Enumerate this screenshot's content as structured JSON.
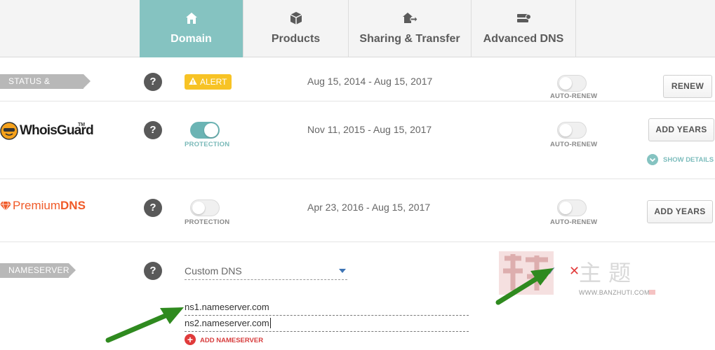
{
  "tabs": [
    {
      "label": "Domain",
      "icon": "home-icon",
      "active": true
    },
    {
      "label": "Products",
      "icon": "box-icon",
      "active": false
    },
    {
      "label": "Sharing & Transfer",
      "icon": "transfer-icon",
      "active": false
    },
    {
      "label": "Advanced DNS",
      "icon": "server-icon",
      "active": false
    }
  ],
  "status": {
    "section_label": "STATUS & VALIDITY",
    "alert_label": "ALERT",
    "dates": "Aug 15, 2014 - Aug 15, 2017",
    "autorenew_caption": "AUTO-RENEW",
    "autorenew_on": false,
    "button_label": "RENEW"
  },
  "whoisguard": {
    "logo_text": "WhoisGuard",
    "logo_tm": "TM",
    "protection_caption": "PROTECTION",
    "protection_on": true,
    "dates": "Nov 11, 2015 - Aug 15, 2017",
    "autorenew_caption": "AUTO-RENEW",
    "autorenew_on": false,
    "button_label": "ADD YEARS",
    "show_details": "SHOW DETAILS"
  },
  "premiumdns": {
    "logo_text_light": "Premium",
    "logo_text_bold": "DNS",
    "protection_caption": "PROTECTION",
    "protection_on": false,
    "dates": "Apr 23, 2016 - Aug 15, 2017",
    "autorenew_caption": "AUTO-RENEW",
    "autorenew_on": false,
    "button_label": "ADD YEARS"
  },
  "nameservers": {
    "section_label": "NAMESERVERS",
    "dns_type": "Custom DNS",
    "entries": [
      "ns1.nameserver.com",
      "ns2.nameserver.com"
    ],
    "add_label": "ADD NAMESERVER",
    "check_symbol": "✓",
    "cancel_symbol": "✕"
  },
  "help_symbol": "?",
  "watermark": {
    "chars": "主 题",
    "url": "WWW.BANZHUTI.COM"
  },
  "colors": {
    "accent": "#85c3c1",
    "alert": "#f7c325",
    "brand_orange": "#f05a28",
    "danger": "#e03b3b",
    "arrow_green": "#2f8a1f"
  }
}
